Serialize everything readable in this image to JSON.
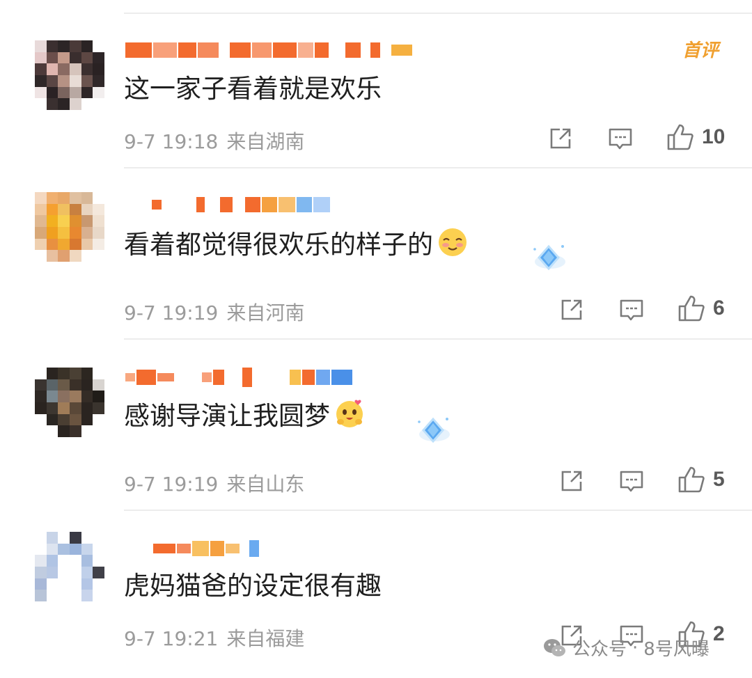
{
  "comments": [
    {
      "text": "这一家子看着就是欢乐",
      "time": "9-7 19:18",
      "location": "来自湖南",
      "likes": "10",
      "badge": "首评",
      "emoji": ""
    },
    {
      "text": "看着都觉得很欢乐的样子的",
      "time": "9-7 19:19",
      "location": "来自河南",
      "likes": "6",
      "badge": "",
      "emoji": "blushing-smile-emoji"
    },
    {
      "text": "感谢导演让我圆梦",
      "time": "9-7 19:19",
      "location": "来自山东",
      "likes": "5",
      "badge": "",
      "emoji": "heart-eyes-hug-emoji"
    },
    {
      "text": "虎妈猫爸的设定很有趣",
      "time": "9-7 19:21",
      "location": "来自福建",
      "likes": "2",
      "badge": "",
      "emoji": ""
    }
  ],
  "watermark": {
    "source": "公众号",
    "separator": "·",
    "account": "8号风曝"
  },
  "colors": {
    "meta_text": "#9b9b9b",
    "badge": "#f0a030",
    "username_orange": "#f06a2a",
    "username_blue": "#5aa0f0"
  },
  "icons": [
    "share-icon",
    "comment-icon",
    "thumbs-up-icon",
    "blushing-smile-emoji",
    "heart-eyes-hug-emoji",
    "diamond-badge-icon",
    "wechat-icon"
  ]
}
